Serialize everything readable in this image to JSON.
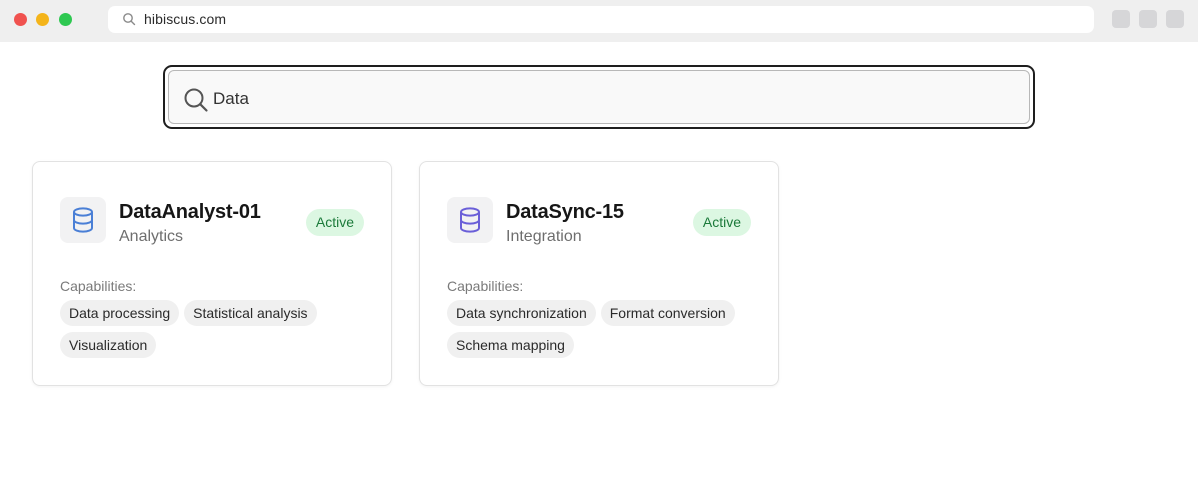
{
  "browser": {
    "url": "hibiscus.com"
  },
  "search": {
    "value": "Data",
    "icon": "search-icon"
  },
  "cards": [
    {
      "name": "DataAnalyst-01",
      "type": "Analytics",
      "status": "Active",
      "icon": "database-icon",
      "icon_color": "#4a7fd6",
      "capabilities_label": "Capabilities:",
      "capabilities": [
        "Data processing",
        "Statistical analysis",
        "Visualization"
      ]
    },
    {
      "name": "DataSync-15",
      "type": "Integration",
      "status": "Active",
      "icon": "database-icon",
      "icon_color": "#6a5fd8",
      "capabilities_label": "Capabilities:",
      "capabilities": [
        "Data synchronization",
        "Format conversion",
        "Schema mapping"
      ]
    }
  ],
  "colors": {
    "status_active_bg": "#dcf7e2",
    "status_active_text": "#1b7a3a"
  }
}
